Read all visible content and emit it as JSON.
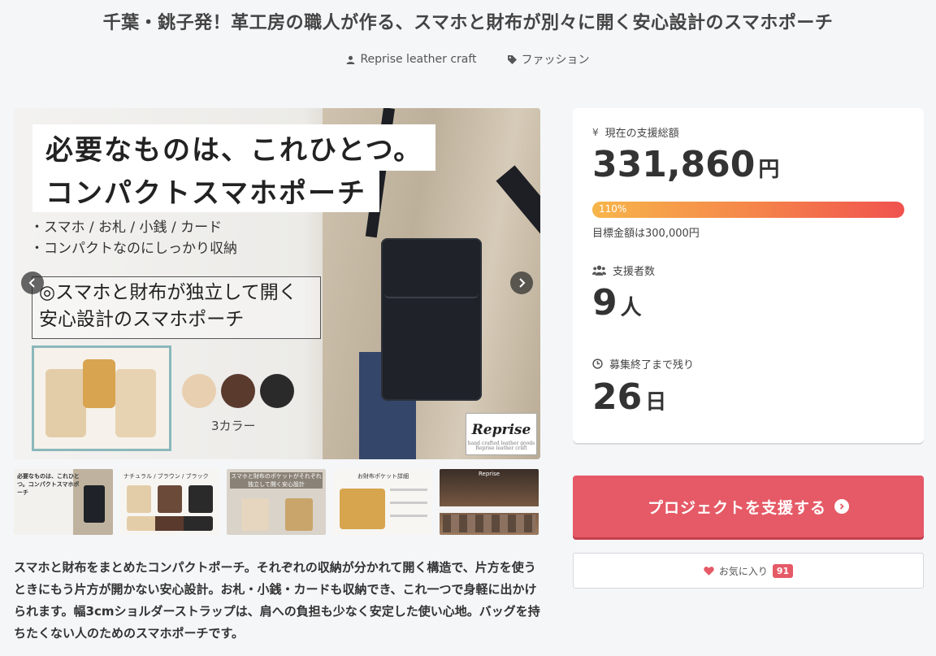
{
  "project": {
    "title": "千葉・銚子発！革工房の職人が作る、スマホと財布が別々に開く安心設計のスマホポーチ",
    "owner": "Reprise leather craft",
    "category": "ファッション"
  },
  "hero": {
    "headline1": "必要なものは、これひとつ。",
    "headline2": "コンパクトスマホポーチ",
    "bullet1": "・スマホ / お札 / 小銭 / カード",
    "bullet2": "・コンパクトなのにしっかり収納",
    "box_line1": "◎スマホと財布が独立して開く",
    "box_line2": "安心設計のスマホポーチ",
    "colors_label": "3カラー",
    "color_swatches": [
      "#e8cfb0",
      "#5b3a2e",
      "#2a2a2a"
    ],
    "logo_text": "Reprise",
    "logo_sub": "hand crafted leather goods Reprise leather craft"
  },
  "thumbnails": [
    {
      "caption": "必要なものは、これひとつ。コンパクトスマホポーチ"
    },
    {
      "caption": "ナチュラル / ブラウン / ブラック"
    },
    {
      "caption": "スマホと財布のポケットがそれぞれ独立して開く安心設計"
    },
    {
      "caption": "お財布ポケット詳細"
    },
    {
      "caption": "Reprise"
    }
  ],
  "description": "スマホと財布をまとめたコンパクトポーチ。それぞれの収納が分かれて開く構造で、片方を使うときにもう片方が開かない安心設計。お札・小銭・カードも収納でき、これ一つで身軽に出かけられます。幅3cmショルダーストラップは、肩への負担も少なく安定した使い心地。バッグを持ちたくない人のためのスマホポーチです。",
  "stats": {
    "amount_label": "現在の支援総額",
    "amount": "331,860",
    "amount_unit": "円",
    "progress_text": "110%",
    "progress": 1.1,
    "goal_text": "目標金額は300,000円",
    "backers_label": "支援者数",
    "backers": "9",
    "backers_unit": "人",
    "remaining_label": "募集終了まで残り",
    "remaining": "26",
    "remaining_unit": "日"
  },
  "actions": {
    "support_label": "プロジェクトを支援する",
    "favorite_label": "お気に入り",
    "favorite_count": "91"
  },
  "colors": {
    "accent": "#e55a66",
    "progress_start": "#f7b54a",
    "progress_end": "#f0524e"
  }
}
